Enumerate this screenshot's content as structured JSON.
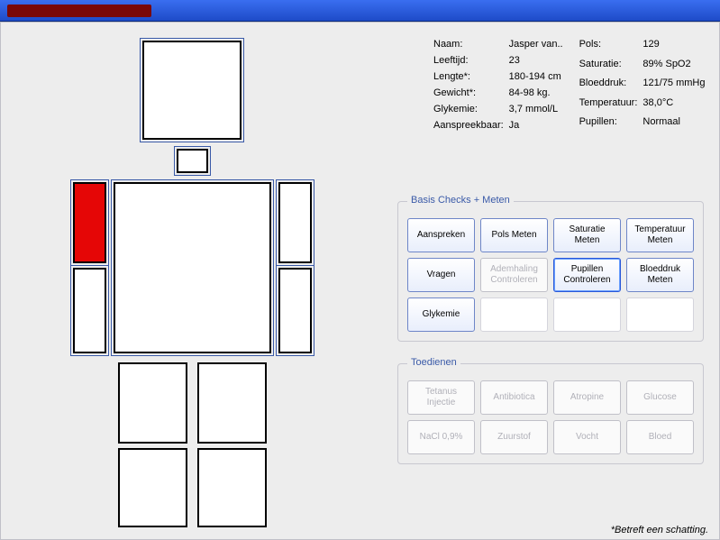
{
  "titlebar": {
    "redacted": true
  },
  "patient": {
    "left": [
      {
        "label": "Naam:",
        "value": "Jasper van.."
      },
      {
        "label": "Leeftijd:",
        "value": "23"
      },
      {
        "label": "Lengte*:",
        "value": "180-194 cm"
      },
      {
        "label": "Gewicht*:",
        "value": "84-98 kg."
      },
      {
        "label": "Glykemie:",
        "value": "3,7 mmol/L"
      },
      {
        "label": "Aanspreekbaar:",
        "value": "Ja"
      }
    ],
    "right": [
      {
        "label": "Pols:",
        "value": "129"
      },
      {
        "label": "Saturatie:",
        "value": "89% SpO2"
      },
      {
        "label": "Bloeddruk:",
        "value": "121/75 mmHg"
      },
      {
        "label": "Temperatuur:",
        "value": "38,0°C"
      },
      {
        "label": "Pupillen:",
        "value": "Normaal"
      }
    ]
  },
  "body_parts": {
    "head": "normal",
    "neck": "normal",
    "torso": "normal",
    "arm_right_upper": "injured",
    "arm_right_lower": "normal",
    "arm_left_upper": "normal",
    "arm_left_lower": "normal",
    "leg_right_upper": "normal",
    "leg_right_lower": "normal",
    "leg_left_upper": "normal",
    "leg_left_lower": "normal"
  },
  "panels": {
    "checks": {
      "title": "Basis Checks + Meten",
      "buttons": [
        {
          "label": "Aanspreken",
          "state": "normal"
        },
        {
          "label": "Pols Meten",
          "state": "normal"
        },
        {
          "label": "Saturatie Meten",
          "state": "normal"
        },
        {
          "label": "Temperatuur Meten",
          "state": "normal"
        },
        {
          "label": "Vragen",
          "state": "normal"
        },
        {
          "label": "Ademhaling Controleren",
          "state": "disabled"
        },
        {
          "label": "Pupillen Controleren",
          "state": "highlight"
        },
        {
          "label": "Bloeddruk Meten",
          "state": "normal"
        },
        {
          "label": "Glykemie",
          "state": "normal"
        },
        {
          "label": "",
          "state": "blank"
        },
        {
          "label": "",
          "state": "blank"
        },
        {
          "label": "",
          "state": "blank"
        }
      ]
    },
    "admin": {
      "title": "Toedienen",
      "buttons": [
        {
          "label": "Tetanus Injectie",
          "state": "disabled"
        },
        {
          "label": "Antibiotica",
          "state": "disabled"
        },
        {
          "label": "Atropine",
          "state": "disabled"
        },
        {
          "label": "Glucose",
          "state": "disabled"
        },
        {
          "label": "NaCl 0,9%",
          "state": "disabled"
        },
        {
          "label": "Zuurstof",
          "state": "disabled"
        },
        {
          "label": "Vocht",
          "state": "disabled"
        },
        {
          "label": "Bloed",
          "state": "disabled"
        }
      ]
    }
  },
  "footnote": "*Betreft een schatting."
}
